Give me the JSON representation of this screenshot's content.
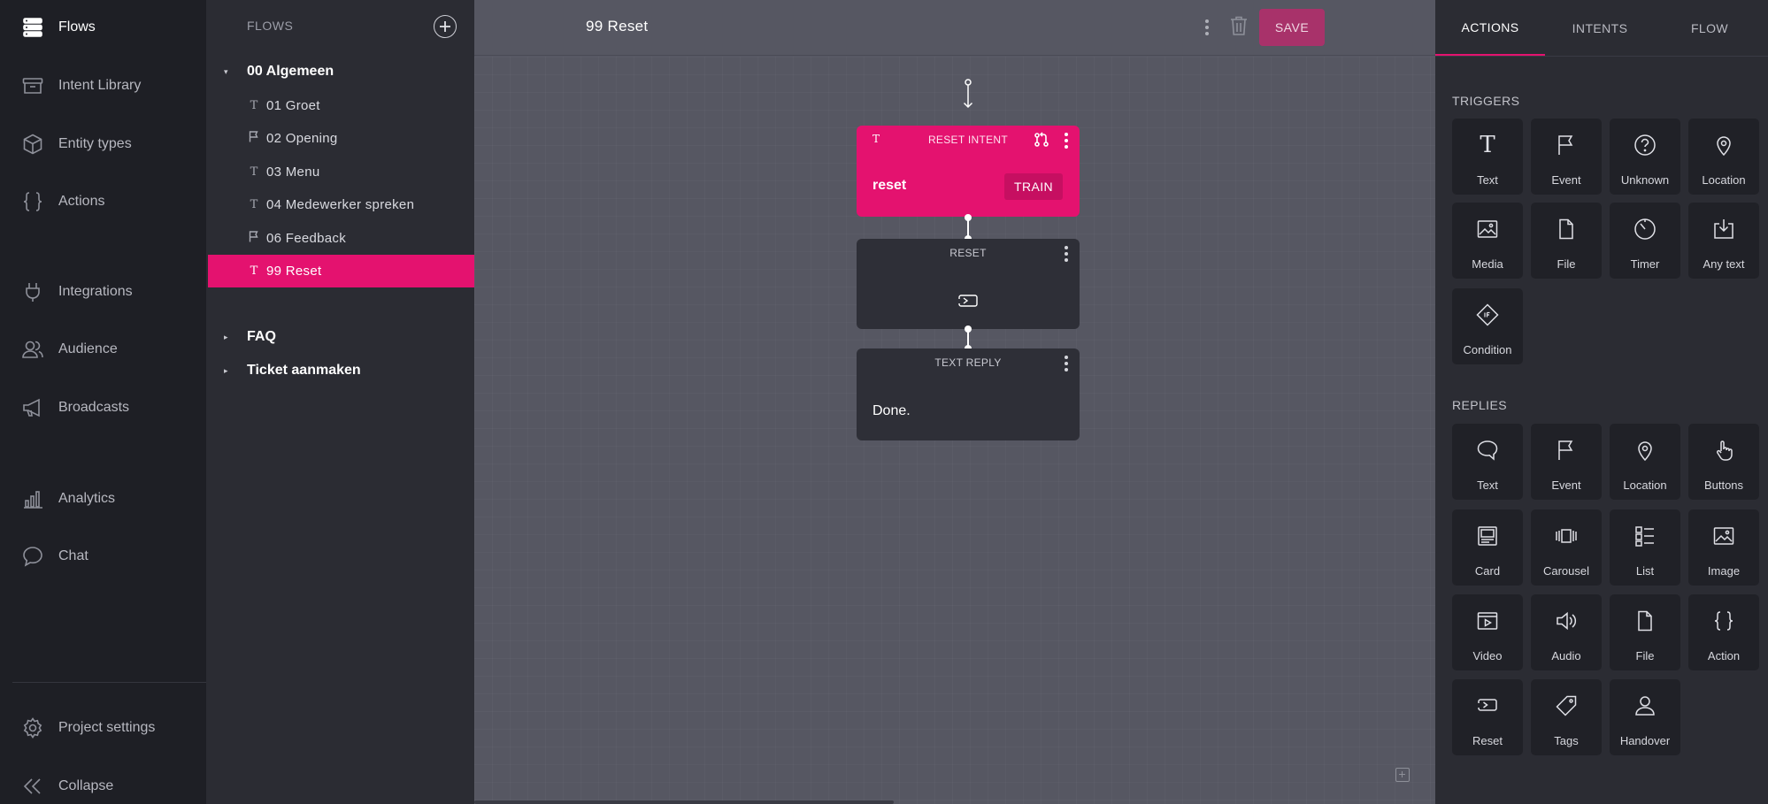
{
  "nav": {
    "items": [
      {
        "label": "Flows",
        "icon": "flows-icon"
      },
      {
        "label": "Intent Library",
        "icon": "archive-icon"
      },
      {
        "label": "Entity types",
        "icon": "cube-icon"
      },
      {
        "label": "Actions",
        "icon": "braces-icon"
      },
      {
        "label": "Integrations",
        "icon": "plug-icon"
      },
      {
        "label": "Audience",
        "icon": "users-icon"
      },
      {
        "label": "Broadcasts",
        "icon": "megaphone-icon"
      },
      {
        "label": "Analytics",
        "icon": "analytics-icon"
      },
      {
        "label": "Chat",
        "icon": "chat-icon"
      }
    ],
    "bottom": [
      {
        "label": "Project settings",
        "icon": "gear-icon"
      },
      {
        "label": "Collapse",
        "icon": "collapse-icon"
      }
    ]
  },
  "flows": {
    "title": "FLOWS",
    "groups": [
      {
        "name": "00 Algemeen",
        "items": [
          {
            "name": "01 Groet",
            "type": "text"
          },
          {
            "name": "02 Opening",
            "type": "event"
          },
          {
            "name": "03 Menu",
            "type": "text"
          },
          {
            "name": "04 Medewerker spreken",
            "type": "text"
          },
          {
            "name": "06 Feedback",
            "type": "event"
          },
          {
            "name": "99 Reset",
            "type": "text"
          }
        ]
      },
      {
        "name": "FAQ"
      },
      {
        "name": "Ticket aanmaken"
      }
    ]
  },
  "toolbar": {
    "flow_title": "99 Reset",
    "save_label": "SAVE"
  },
  "canvas": {
    "trigger": {
      "title": "RESET INTENT",
      "type_glyph": "T",
      "value": "reset",
      "train_label": "TRAIN"
    },
    "reset": {
      "title": "RESET"
    },
    "reply": {
      "title": "TEXT REPLY",
      "text": "Done."
    }
  },
  "panel": {
    "tabs": [
      "ACTIONS",
      "INTENTS",
      "FLOW"
    ],
    "triggers_title": "TRIGGERS",
    "triggers": [
      "Text",
      "Event",
      "Unknown",
      "Location",
      "Media",
      "File",
      "Timer",
      "Any text",
      "Condition"
    ],
    "replies_title": "REPLIES",
    "replies": [
      "Text",
      "Event",
      "Location",
      "Buttons",
      "Card",
      "Carousel",
      "List",
      "Image",
      "Video",
      "Audio",
      "File",
      "Action",
      "Reset",
      "Tags",
      "Handover"
    ]
  },
  "colors": {
    "accent": "#e4126f",
    "nav_bg": "#1e1f25",
    "panel_bg": "#2b2c33",
    "canvas_bg": "#565762"
  }
}
